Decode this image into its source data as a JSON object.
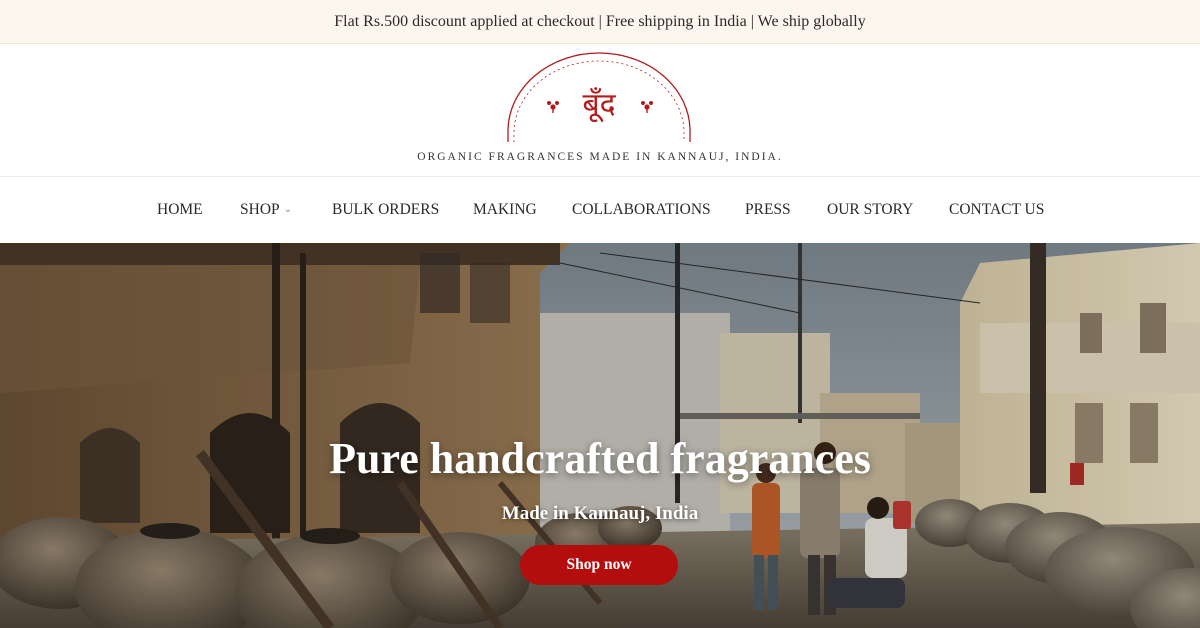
{
  "announcement": "Flat Rs.500 discount applied at checkout | Free shipping in India | We ship globally",
  "brand": {
    "logo_text": "बूँद",
    "tagline": "ORGANIC FRAGRANCES MADE IN KANNAUJ, INDIA.",
    "accent_color": "#b31b1b"
  },
  "nav": {
    "items": [
      {
        "label": "HOME"
      },
      {
        "label": "SHOP",
        "has_dropdown": true
      },
      {
        "label": "BULK ORDERS"
      },
      {
        "label": "MAKING"
      },
      {
        "label": "COLLABORATIONS"
      },
      {
        "label": "PRESS"
      },
      {
        "label": "OUR STORY"
      },
      {
        "label": "CONTACT US"
      }
    ],
    "dropdown_icon": "chevron-down-icon"
  },
  "hero": {
    "title": "Pure handcrafted fragrances",
    "subtitle": "Made in Kannauj, India",
    "cta_label": "Shop now",
    "cta_color": "#b40d0d"
  }
}
